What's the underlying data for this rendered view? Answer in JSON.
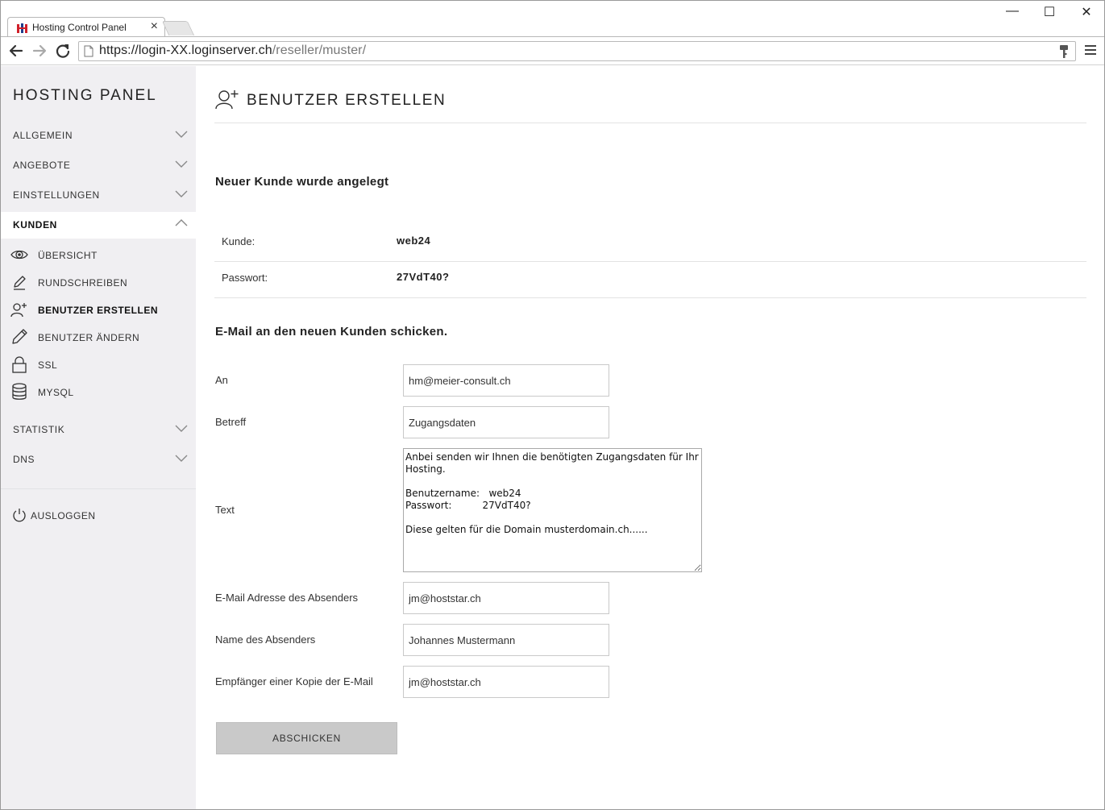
{
  "browser": {
    "tab_title": "Hosting Control Panel",
    "tab_close": "×",
    "url_host": "https://login-XX.loginserver.ch",
    "url_path": "/reseller/muster/",
    "window_minimize": "—",
    "window_maximize": "☐",
    "window_close": "✕"
  },
  "sidebar": {
    "brand": "HOSTING PANEL",
    "sections": [
      {
        "label": "ALLGEMEIN",
        "expanded": false
      },
      {
        "label": "ANGEBOTE",
        "expanded": false
      },
      {
        "label": "EINSTELLUNGEN",
        "expanded": false
      },
      {
        "label": "KUNDEN",
        "expanded": true
      }
    ],
    "kunden_items": [
      {
        "label": "ÜBERSICHT",
        "icon": "eye-icon"
      },
      {
        "label": "RUNDSCHREIBEN",
        "icon": "pen-icon"
      },
      {
        "label": "BENUTZER ERSTELLEN",
        "icon": "user-plus-icon",
        "current": true
      },
      {
        "label": "BENUTZER ÄNDERN",
        "icon": "pencil-icon"
      },
      {
        "label": "SSL",
        "icon": "lock-icon"
      },
      {
        "label": "MYSQL",
        "icon": "database-icon"
      }
    ],
    "sections_after": [
      {
        "label": "STATISTIK",
        "expanded": false
      },
      {
        "label": "DNS",
        "expanded": false
      }
    ],
    "logout": "AUSLOGGEN"
  },
  "main": {
    "title": "BENUTZER ERSTELLEN",
    "created_heading": "Neuer Kunde wurde angelegt",
    "info": [
      {
        "key": "Kunde:",
        "value": "web24"
      },
      {
        "key": "Passwort:",
        "value": "27VdT40?"
      }
    ],
    "email_heading": "E-Mail an den neuen Kunden schicken.",
    "form": {
      "to_label": "An",
      "to_value": "hm@meier-consult.ch",
      "subject_label": "Betreff",
      "subject_value": "Zugangsdaten",
      "text_label": "Text",
      "text_value": "Anbei senden wir Ihnen die benötigten Zugangsdaten für Ihr Hosting.\n\nBenutzername:   web24\nPasswort:          27VdT40?\n\nDiese gelten für die Domain musterdomain.ch......",
      "sender_email_label": "E-Mail Adresse des Absenders",
      "sender_email_value": "jm@hoststar.ch",
      "sender_name_label": "Name des Absenders",
      "sender_name_value": "Johannes Mustermann",
      "cc_label": "Empfänger einer Kopie der E-Mail",
      "cc_value": "jm@hoststar.ch",
      "submit_label": "ABSCHICKEN"
    }
  }
}
